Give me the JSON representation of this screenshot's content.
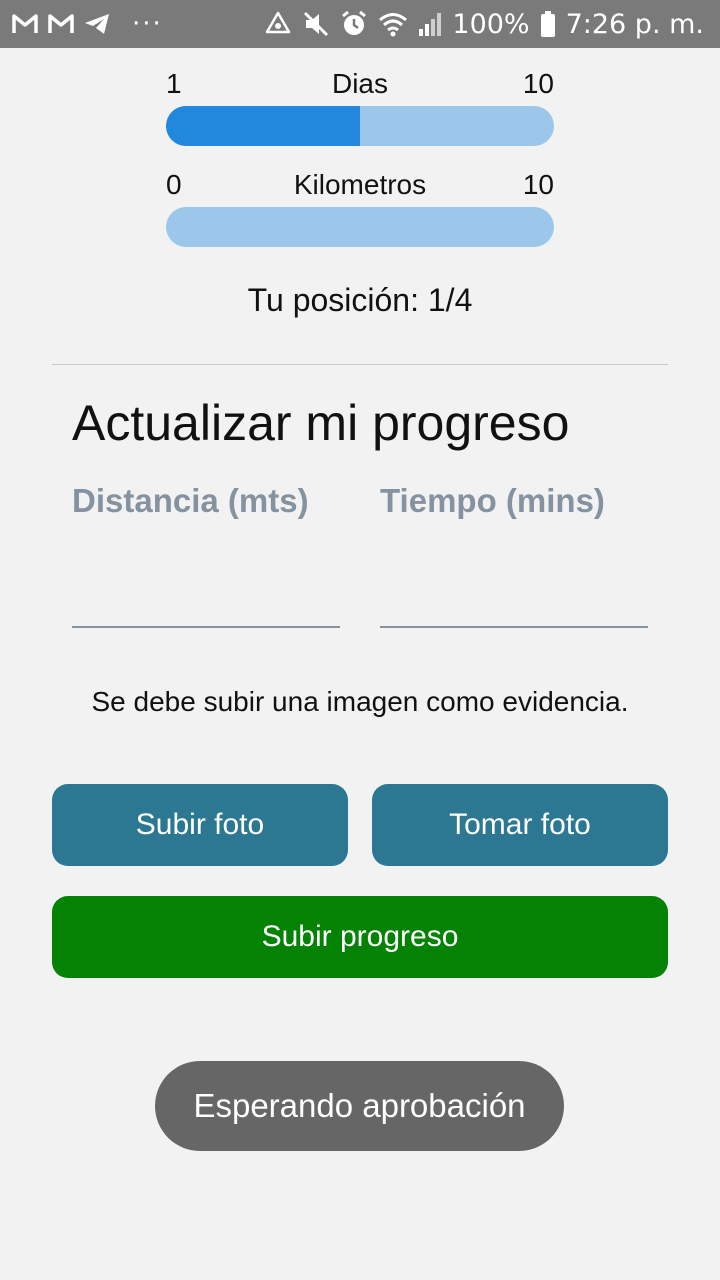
{
  "status_bar": {
    "left_icons": [
      "gmail-icon",
      "gmail-icon",
      "telegram-icon"
    ],
    "dots": "···",
    "right_icons": [
      "data-saver-icon",
      "mute-icon",
      "alarm-icon",
      "wifi-icon",
      "signal-icon",
      "battery-icon"
    ],
    "battery": "100%",
    "time": "7:26 p. m."
  },
  "progress": {
    "days": {
      "min": "1",
      "label": "Dias",
      "max": "10",
      "fraction": 0.5
    },
    "kilometers": {
      "min": "0",
      "label": "Kilometros",
      "max": "10",
      "fraction": 0.0
    }
  },
  "position_text": "Tu posición: 1/4",
  "form": {
    "title": "Actualizar mi progreso",
    "distance_label": "Distancia (mts)",
    "distance_value": "",
    "time_label": "Tiempo (mins)",
    "time_value": "",
    "evidence_note": "Se debe subir una imagen como evidencia."
  },
  "buttons": {
    "upload_photo": "Subir foto",
    "take_photo": "Tomar foto",
    "submit_progress": "Subir progreso"
  },
  "toast": "Esperando aprobación",
  "colors": {
    "progress_fill": "#2288dd",
    "progress_track": "#9dc7ea",
    "button_teal": "#2c7791",
    "button_green": "#038203",
    "toast_bg": "#666666"
  }
}
